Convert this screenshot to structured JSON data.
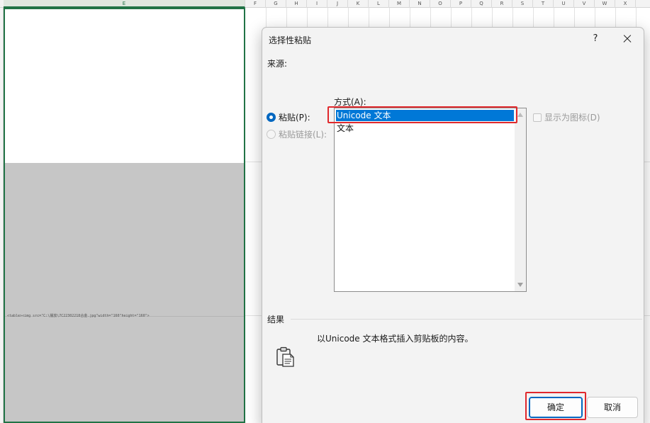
{
  "sheet": {
    "column_header_e": "E",
    "column_headers": [
      "F",
      "G",
      "H",
      "I",
      "J",
      "K",
      "L",
      "M",
      "N",
      "O",
      "P",
      "Q",
      "R",
      "S",
      "T",
      "U",
      "V",
      "W",
      "X"
    ],
    "cell_content": "<table><img src=\"C:\\播放\\7C22302218合金.jpg\"width=\"160\"height=\"160\">"
  },
  "dialog": {
    "title": "选择性粘贴",
    "help_label": "?",
    "source_label": "来源:",
    "mode_label": "方式(A):",
    "paste_option": "粘贴(P):",
    "paste_link_option": "粘贴链接(L):",
    "list_items": [
      "Unicode 文本",
      "文本"
    ],
    "display_as_icon": "显示为图标(D)",
    "result_label": "结果",
    "result_text": "以Unicode 文本格式插入剪贴板的内容。",
    "ok_button": "确定",
    "cancel_button": "取消"
  },
  "colors": {
    "accent": "#0067c0",
    "selection": "#0078d7",
    "highlight": "#e0282c",
    "excel_green": "#217346"
  },
  "icons": [
    "clipboard-icon",
    "close-icon",
    "help-icon"
  ]
}
